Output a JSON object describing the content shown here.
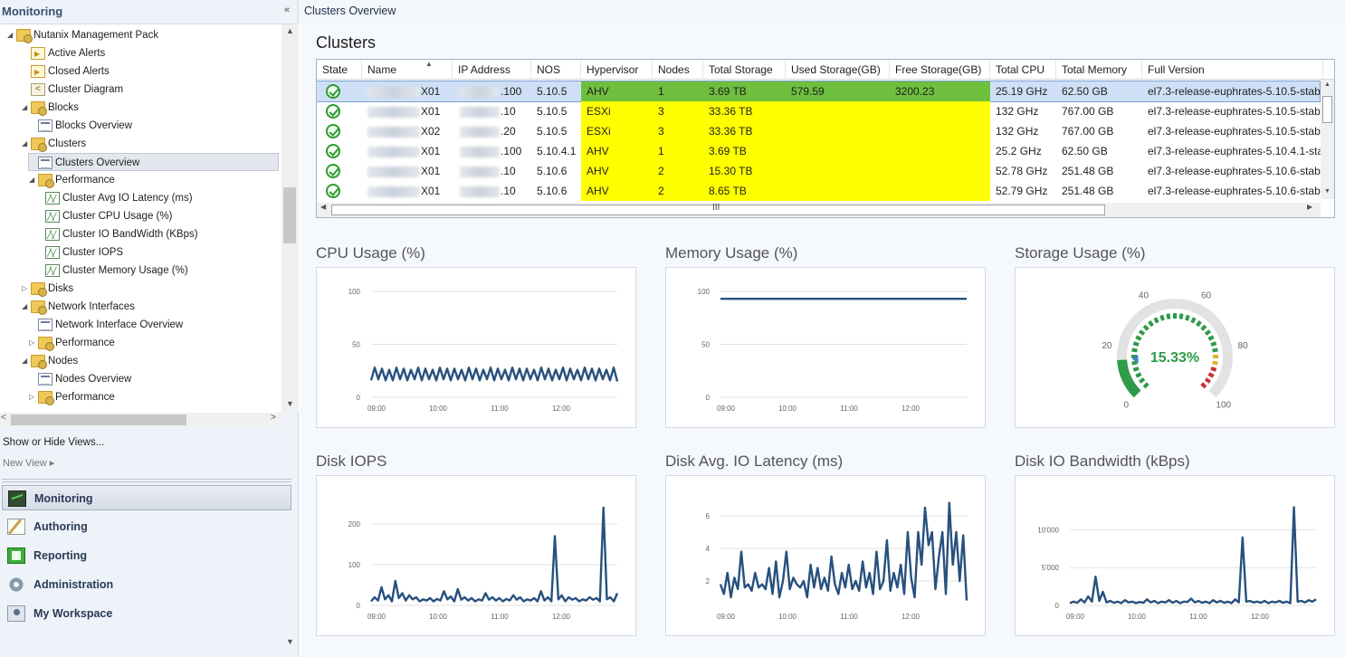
{
  "left_pane": {
    "title": "Monitoring",
    "collapse_glyph": "«",
    "tree": [
      {
        "label": "Nutanix Management Pack",
        "level": 0,
        "icon": "folder-icon",
        "expander": "◢"
      },
      {
        "label": "Active Alerts",
        "level": 1,
        "icon": "alert-view-icon",
        "expander": ""
      },
      {
        "label": "Closed Alerts",
        "level": 1,
        "icon": "alert-view-icon",
        "expander": ""
      },
      {
        "label": "Cluster Diagram",
        "level": 1,
        "icon": "diagram-icon",
        "expander": ""
      },
      {
        "label": "Blocks",
        "level": 1,
        "icon": "folder-icon",
        "expander": "◢"
      },
      {
        "label": "Blocks Overview",
        "level": 2,
        "icon": "state-view-icon",
        "expander": ""
      },
      {
        "label": "Clusters",
        "level": 1,
        "icon": "folder-icon",
        "expander": "◢"
      },
      {
        "label": "Clusters Overview",
        "level": 2,
        "icon": "state-view-icon",
        "expander": "",
        "selected": true
      },
      {
        "label": "Performance",
        "level": 2,
        "icon": "folder-icon",
        "expander": "◢"
      },
      {
        "label": "Cluster Avg IO Latency (ms)",
        "level": 3,
        "icon": "chart-view-icon",
        "expander": ""
      },
      {
        "label": "Cluster CPU Usage (%)",
        "level": 3,
        "icon": "chart-view-icon",
        "expander": ""
      },
      {
        "label": "Cluster IO BandWidth (KBps)",
        "level": 3,
        "icon": "chart-view-icon",
        "expander": ""
      },
      {
        "label": "Cluster IOPS",
        "level": 3,
        "icon": "chart-view-icon",
        "expander": ""
      },
      {
        "label": "Cluster Memory Usage (%)",
        "level": 3,
        "icon": "chart-view-icon",
        "expander": ""
      },
      {
        "label": "Disks",
        "level": 1,
        "icon": "folder-icon",
        "expander": "▷"
      },
      {
        "label": "Network Interfaces",
        "level": 1,
        "icon": "folder-icon",
        "expander": "◢"
      },
      {
        "label": "Network Interface Overview",
        "level": 2,
        "icon": "state-view-icon",
        "expander": ""
      },
      {
        "label": "Performance",
        "level": 2,
        "icon": "folder-icon",
        "expander": "▷"
      },
      {
        "label": "Nodes",
        "level": 1,
        "icon": "folder-icon",
        "expander": "◢"
      },
      {
        "label": "Nodes Overview",
        "level": 2,
        "icon": "state-view-icon",
        "expander": ""
      },
      {
        "label": "Performance",
        "level": 2,
        "icon": "folder-icon",
        "expander": "▷"
      }
    ],
    "show_hide_views": "Show or Hide Views...",
    "new_view": "New View ▸",
    "workspaces": [
      {
        "label": "Monitoring",
        "icon": "monitoring-icon",
        "active": true
      },
      {
        "label": "Authoring",
        "icon": "authoring-icon"
      },
      {
        "label": "Reporting",
        "icon": "reporting-icon"
      },
      {
        "label": "Administration",
        "icon": "administration-icon"
      },
      {
        "label": "My Workspace",
        "icon": "my-workspace-icon"
      }
    ]
  },
  "main": {
    "title": "Clusters Overview",
    "clusters_heading": "Clusters",
    "columns": [
      "State",
      "Name",
      "IP Address",
      "NOS",
      "Hypervisor",
      "Nodes",
      "Total Storage",
      "Used Storage(GB)",
      "Free Storage(GB)",
      "Total CPU",
      "Total Memory",
      "Full Version"
    ],
    "rows": [
      {
        "state": "healthy",
        "name": "X01",
        "ip": ".100",
        "nos": "5.10.5",
        "hypervisor": "AHV",
        "nodes": "1",
        "total_storage": "3.69 TB",
        "used_storage": "579.59",
        "free_storage": "3200.23",
        "total_cpu": "25.19 GHz",
        "total_memory": "62.50 GB",
        "full_version": "el7.3-release-euphrates-5.10.5-stab",
        "selected": true,
        "highlight": "green"
      },
      {
        "state": "healthy",
        "name": "X01",
        "ip": ".10",
        "nos": "5.10.5",
        "hypervisor": "ESXi",
        "nodes": "3",
        "total_storage": "33.36 TB",
        "used_storage": "",
        "free_storage": "",
        "total_cpu": "132 GHz",
        "total_memory": "767.00 GB",
        "full_version": "el7.3-release-euphrates-5.10.5-stab",
        "highlight": "yellow"
      },
      {
        "state": "healthy",
        "name": "X02",
        "ip": ".20",
        "nos": "5.10.5",
        "hypervisor": "ESXi",
        "nodes": "3",
        "total_storage": "33.36 TB",
        "used_storage": "",
        "free_storage": "",
        "total_cpu": "132 GHz",
        "total_memory": "767.00 GB",
        "full_version": "el7.3-release-euphrates-5.10.5-stab",
        "highlight": "yellow"
      },
      {
        "state": "healthy",
        "name": "X01",
        "ip": ".100",
        "nos": "5.10.4.1",
        "hypervisor": "AHV",
        "nodes": "1",
        "total_storage": "3.69 TB",
        "used_storage": "",
        "free_storage": "",
        "total_cpu": "25.2 GHz",
        "total_memory": "62.50 GB",
        "full_version": "el7.3-release-euphrates-5.10.4.1-sta",
        "highlight": "yellow"
      },
      {
        "state": "healthy",
        "name": "X01",
        "ip": ".10",
        "nos": "5.10.6",
        "hypervisor": "AHV",
        "nodes": "2",
        "total_storage": "15.30 TB",
        "used_storage": "",
        "free_storage": "",
        "total_cpu": "52.78 GHz",
        "total_memory": "251.48 GB",
        "full_version": "el7.3-release-euphrates-5.10.6-stab",
        "highlight": "yellow"
      },
      {
        "state": "healthy",
        "name": "X01",
        "ip": ".10",
        "nos": "5.10.6",
        "hypervisor": "AHV",
        "nodes": "2",
        "total_storage": "8.65 TB",
        "used_storage": "",
        "free_storage": "",
        "total_cpu": "52.79 GHz",
        "total_memory": "251.48 GB",
        "full_version": "el7.3-release-euphrates-5.10.6-stab",
        "highlight": "yellow"
      }
    ],
    "scroll_grip": "III",
    "colors": {
      "selected_green": "#6fbf3f",
      "warn_yellow": "#ffff00",
      "series": "#27507e",
      "gauge_green": "#2e9a4a"
    }
  },
  "chart_data": [
    {
      "type": "line",
      "title": "CPU Usage (%)",
      "x_ticks": [
        "09:00",
        "10:00",
        "11:00",
        "12:00"
      ],
      "y_ticks": [
        "0",
        "50",
        "100"
      ],
      "ylim": [
        0,
        100
      ],
      "series": [
        {
          "values": [
            16,
            28,
            17,
            27,
            16,
            26,
            16,
            28,
            17,
            27,
            16,
            26,
            17,
            28,
            16,
            27,
            17,
            26,
            16,
            28,
            17,
            27,
            16,
            27,
            17,
            26,
            16,
            28,
            17,
            27,
            16,
            26,
            17,
            28,
            16,
            27,
            17,
            26,
            16,
            28,
            17,
            27,
            16,
            27,
            17,
            26,
            16,
            28,
            17,
            27,
            16,
            26,
            17,
            28,
            16,
            27,
            17,
            26,
            16,
            28,
            17,
            27,
            16,
            27,
            17,
            26,
            16,
            28,
            15
          ]
        }
      ]
    },
    {
      "type": "line",
      "title": "Memory Usage (%)",
      "x_ticks": [
        "09:00",
        "10:00",
        "11:00",
        "12:00"
      ],
      "y_ticks": [
        "0",
        "50",
        "100"
      ],
      "ylim": [
        0,
        100
      ],
      "series": [
        {
          "values": [
            93,
            93,
            93,
            93,
            93,
            93,
            93,
            93,
            93,
            93
          ]
        }
      ]
    },
    {
      "type": "gauge",
      "title": "Storage Usage (%)",
      "value": 15.33,
      "display": "15.33%",
      "min": 0,
      "max": 100,
      "tick_labels": [
        "0",
        "20",
        "40",
        "60",
        "80",
        "100"
      ],
      "tick_values": [
        0,
        20,
        40,
        60,
        80,
        100
      ]
    },
    {
      "type": "line",
      "title": "Disk IOPS",
      "x_ticks": [
        "09:00",
        "10:00",
        "11:00",
        "12:00"
      ],
      "y_ticks": [
        "0",
        "100",
        "200"
      ],
      "ylim": [
        0,
        260
      ],
      "series": [
        {
          "values": [
            10,
            20,
            12,
            45,
            15,
            25,
            10,
            60,
            18,
            30,
            12,
            25,
            15,
            20,
            10,
            15,
            12,
            18,
            10,
            16,
            12,
            35,
            15,
            22,
            10,
            40,
            14,
            20,
            12,
            18,
            10,
            15,
            12,
            30,
            14,
            20,
            12,
            18,
            10,
            16,
            12,
            25,
            14,
            20,
            10,
            15,
            12,
            18,
            10,
            35,
            12,
            20,
            10,
            170,
            15,
            25,
            10,
            20,
            14,
            18,
            10,
            15,
            12,
            20,
            14,
            18,
            10,
            240,
            15,
            20,
            10,
            30
          ]
        }
      ]
    },
    {
      "type": "line",
      "title": "Disk Avg. IO Latency (ms)",
      "x_ticks": [
        "09:00",
        "10:00",
        "11:00",
        "12:00"
      ],
      "y_ticks": [
        "2",
        "4",
        "6"
      ],
      "ylim": [
        0.5,
        7
      ],
      "series": [
        {
          "values": [
            1.8,
            1.2,
            2.5,
            1.0,
            2.2,
            1.5,
            3.8,
            1.6,
            1.8,
            1.4,
            2.5,
            1.6,
            1.8,
            1.5,
            2.8,
            1.2,
            3.2,
            1.0,
            2.0,
            3.8,
            1.5,
            2.2,
            1.8,
            1.6,
            2.0,
            1.0,
            3.0,
            1.6,
            2.8,
            1.5,
            2.2,
            1.4,
            3.5,
            1.8,
            1.2,
            2.5,
            1.6,
            3.0,
            1.5,
            2.0,
            1.4,
            3.2,
            1.6,
            2.5,
            1.2,
            3.8,
            1.5,
            2.0,
            4.5,
            1.4,
            2.5,
            1.6,
            3.0,
            1.2,
            5.0,
            2.2,
            1.0,
            5.0,
            3.0,
            6.5,
            4.2,
            5.0,
            1.5,
            3.5,
            5.0,
            1.2,
            6.8,
            3.0,
            5.0,
            2.0,
            4.8,
            0.8
          ]
        }
      ]
    },
    {
      "type": "line",
      "title": "Disk IO Bandwidth (kBps)",
      "x_ticks": [
        "09:00",
        "10:00",
        "11:00",
        "12:00"
      ],
      "y_ticks": [
        "0",
        "5'000",
        "10'000"
      ],
      "ylim": [
        0,
        14000
      ],
      "series": [
        {
          "values": [
            300,
            500,
            350,
            800,
            400,
            1200,
            500,
            3800,
            600,
            1800,
            400,
            600,
            350,
            500,
            300,
            700,
            400,
            500,
            300,
            450,
            350,
            800,
            400,
            600,
            300,
            500,
            400,
            700,
            350,
            600,
            300,
            500,
            450,
            900,
            400,
            600,
            350,
            500,
            300,
            700,
            400,
            600,
            350,
            500,
            300,
            800,
            400,
            9000,
            500,
            600,
            400,
            500,
            350,
            600,
            300,
            500,
            400,
            600,
            350,
            500,
            300,
            13000,
            500,
            600,
            400,
            700,
            500,
            800
          ]
        }
      ]
    }
  ]
}
